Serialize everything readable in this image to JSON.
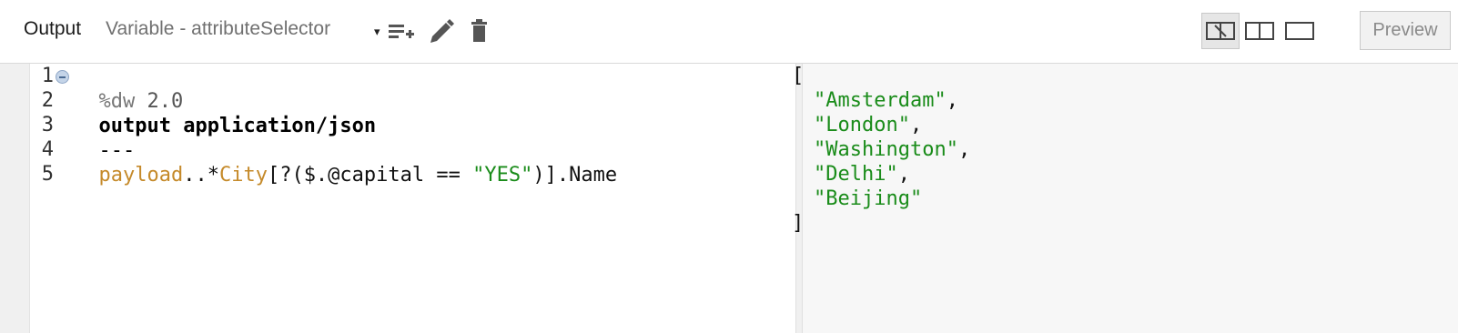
{
  "toolbar": {
    "title": "Output",
    "target_select": "Variable - attributeSelector",
    "caret": "▾",
    "icons": [
      "add-list-icon",
      "edit-pencil-icon",
      "trash-icon"
    ],
    "view_modes": [
      "split-view-icon",
      "two-columns-icon",
      "single-pane-icon"
    ],
    "preview_label": "Preview"
  },
  "editor": {
    "lines": [
      {
        "number": "1",
        "tokens": [
          {
            "t": "%dw ",
            "c": "dir"
          },
          {
            "t": "2.0",
            "c": "num"
          }
        ]
      },
      {
        "number": "2",
        "tokens": [
          {
            "t": "output application/json",
            "c": "kw"
          }
        ]
      },
      {
        "number": "3",
        "tokens": [
          {
            "t": "---",
            "c": "sep"
          }
        ]
      },
      {
        "number": "4",
        "tokens": [
          {
            "t": "payload",
            "c": "id"
          },
          {
            "t": "..*",
            "c": "txt"
          },
          {
            "t": "City",
            "c": "id"
          },
          {
            "t": "[?($.@capital == ",
            "c": "txt"
          },
          {
            "t": "\"YES\"",
            "c": "str"
          },
          {
            "t": ")].Name",
            "c": "txt"
          }
        ]
      },
      {
        "number": "5",
        "tokens": []
      }
    ]
  },
  "output": {
    "open": "[",
    "items": [
      "\"Amsterdam\"",
      "\"London\"",
      "\"Washington\"",
      "\"Delhi\"",
      "\"Beijing\""
    ],
    "close": "]"
  },
  "colors": {
    "string": "#1a8c1a",
    "identifier": "#c58a2a",
    "gutter": "#f0f0f0",
    "output_bg": "#f7f7f7"
  }
}
